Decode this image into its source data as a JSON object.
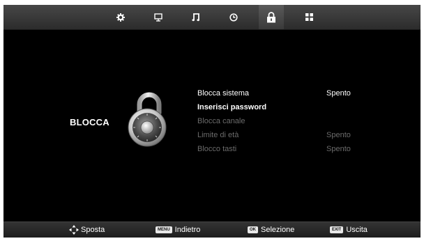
{
  "tabs": [
    {
      "name": "settings-tab",
      "icon": "gear-icon",
      "active": false
    },
    {
      "name": "screen-tab",
      "icon": "monitor-icon",
      "active": false
    },
    {
      "name": "audio-tab",
      "icon": "music-note-icon",
      "active": false
    },
    {
      "name": "time-tab",
      "icon": "clock-icon",
      "active": false
    },
    {
      "name": "lock-tab",
      "icon": "lock-icon",
      "active": true
    },
    {
      "name": "setup-tab",
      "icon": "grid-icon",
      "active": false
    }
  ],
  "section": {
    "title": "BLOCCA",
    "icon": "combination-lock-icon"
  },
  "menu": {
    "items": [
      {
        "label": "Blocca sistema",
        "value": "Spento"
      },
      {
        "label": "Inserisci password",
        "value": ""
      },
      {
        "label": "Blocca canale",
        "value": ""
      },
      {
        "label": "Limite di età",
        "value": "Spento"
      },
      {
        "label": "Blocco tasti",
        "value": "Spento"
      }
    ]
  },
  "footer": {
    "move_label": "Sposta",
    "menu_key": "MENU",
    "back_label": "Indietro",
    "ok_key": "OK",
    "select_label": "Selezione",
    "exit_key": "EXIT",
    "exit_label": "Uscita"
  },
  "colors": {
    "background": "#000000",
    "bar": "#3a3a3a",
    "text": "#ffffff",
    "disabled_text": "#6b6b6b"
  }
}
